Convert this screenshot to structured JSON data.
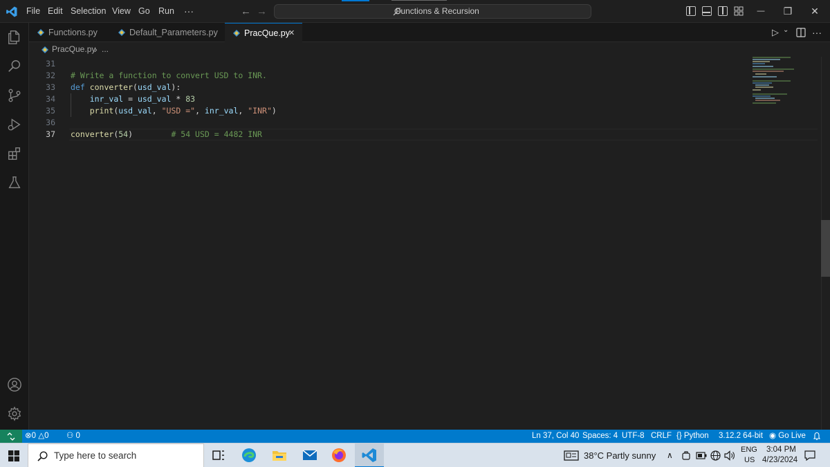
{
  "titlebar": {
    "menus": [
      "File",
      "Edit",
      "Selection",
      "View",
      "Go",
      "Run",
      "···"
    ],
    "back_arrow": "←",
    "forward_arrow": "→",
    "command_center_text": "Functions & Recursion",
    "window_controls": {
      "minimize": "—",
      "restore": "❐",
      "close": "✕"
    }
  },
  "tabs": [
    {
      "label": "Functions.py",
      "active": false
    },
    {
      "label": "Default_Parameters.py",
      "active": false
    },
    {
      "label": "PracQue.py",
      "active": true,
      "close": "✕"
    }
  ],
  "editor_actions": {
    "run": "▷",
    "run_dropdown": "⌄",
    "more": "···"
  },
  "breadcrumbs": {
    "file": "PracQue.py",
    "separator": "›",
    "ellipsis": "..."
  },
  "editor": {
    "lines": [
      {
        "number": "31",
        "tokens": []
      },
      {
        "number": "32",
        "tokens": [
          {
            "c": "cm",
            "t": "# Write a function to convert USD to INR."
          }
        ]
      },
      {
        "number": "33",
        "tokens": [
          {
            "c": "kw",
            "t": "def "
          },
          {
            "c": "fn",
            "t": "converter"
          },
          {
            "c": "op",
            "t": "("
          },
          {
            "c": "var",
            "t": "usd_val"
          },
          {
            "c": "op",
            "t": "):"
          }
        ]
      },
      {
        "number": "34",
        "tokens": [
          {
            "c": "op",
            "t": "    "
          },
          {
            "c": "var",
            "t": "inr_val"
          },
          {
            "c": "op",
            "t": " = "
          },
          {
            "c": "var",
            "t": "usd_val"
          },
          {
            "c": "op",
            "t": " * "
          },
          {
            "c": "num",
            "t": "83"
          }
        ]
      },
      {
        "number": "35",
        "tokens": [
          {
            "c": "op",
            "t": "    "
          },
          {
            "c": "fn",
            "t": "print"
          },
          {
            "c": "op",
            "t": "("
          },
          {
            "c": "var",
            "t": "usd_val"
          },
          {
            "c": "op",
            "t": ", "
          },
          {
            "c": "str",
            "t": "\"USD =\""
          },
          {
            "c": "op",
            "t": ", "
          },
          {
            "c": "var",
            "t": "inr_val"
          },
          {
            "c": "op",
            "t": ", "
          },
          {
            "c": "str",
            "t": "\"INR\""
          },
          {
            "c": "op",
            "t": ")"
          }
        ]
      },
      {
        "number": "36",
        "tokens": []
      },
      {
        "number": "37",
        "current": true,
        "tokens": [
          {
            "c": "fn",
            "t": "converter"
          },
          {
            "c": "op",
            "t": "("
          },
          {
            "c": "num",
            "t": "54"
          },
          {
            "c": "op",
            "t": ")"
          },
          {
            "c": "op",
            "t": "        "
          },
          {
            "c": "cm",
            "t": "# 54 USD = 4482 INR"
          }
        ]
      }
    ]
  },
  "statusbar": {
    "remote_icon": "remote-icon",
    "errors": "0",
    "warnings": "0",
    "ports": "0",
    "cursor_position": "Ln 37, Col 40",
    "spaces": "Spaces: 4",
    "encoding": "UTF-8",
    "eol": "CRLF",
    "language": "Python",
    "interpreter": "3.12.2 64-bit",
    "go_live": "Go Live"
  },
  "taskbar": {
    "search_placeholder": "Type here to search",
    "weather": "38°C  Partly sunny",
    "language_top": "ENG",
    "language_bottom": "US",
    "time": "3:04 PM",
    "date": "4/23/2024"
  },
  "colors": {
    "accent": "#0078d4",
    "statusbar": "#007acc",
    "remote": "#16825d",
    "editor_bg": "#1f1f1f"
  }
}
